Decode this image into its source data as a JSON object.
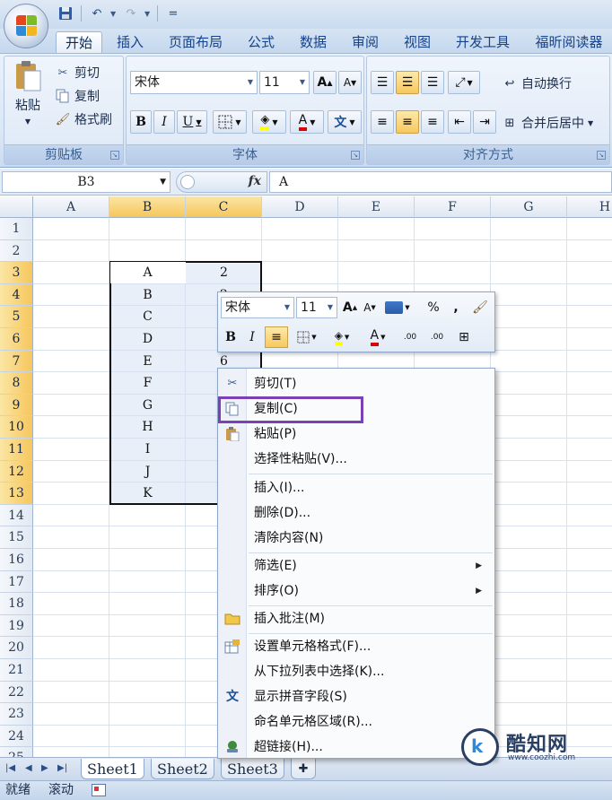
{
  "quick_access": {
    "save_icon": "save-icon",
    "undo_icon": "undo-icon",
    "redo_icon": "redo-icon",
    "customize": "="
  },
  "tabs": [
    "开始",
    "插入",
    "页面布局",
    "公式",
    "数据",
    "审阅",
    "视图",
    "开发工具",
    "福昕阅读器"
  ],
  "ribbon": {
    "clipboard": {
      "paste": "粘贴",
      "cut": "剪切",
      "copy": "复制",
      "format_painter": "格式刷",
      "label": "剪贴板"
    },
    "font": {
      "name": "宋体",
      "size": "11",
      "bold": "B",
      "italic": "I",
      "underline": "U",
      "label": "字体",
      "grow": "A",
      "shrink": "A",
      "font_color": "A",
      "phonetic": "文"
    },
    "alignment": {
      "wrap": "自动换行",
      "merge": "合并后居中",
      "label": "对齐方式"
    }
  },
  "formula_bar": {
    "name_box": "B3",
    "fx": "fx",
    "value": "A"
  },
  "columns": [
    "A",
    "B",
    "C",
    "D",
    "E",
    "F",
    "G",
    "H"
  ],
  "rows": [
    "1",
    "2",
    "3",
    "4",
    "5",
    "6",
    "7",
    "8",
    "9",
    "10",
    "11",
    "12",
    "13",
    "14",
    "15",
    "16",
    "17",
    "18",
    "19",
    "20",
    "21",
    "22",
    "23",
    "24",
    "25"
  ],
  "cells": {
    "B": [
      "A",
      "B",
      "C",
      "D",
      "E",
      "F",
      "G",
      "H",
      "I",
      "J",
      "K"
    ],
    "C": [
      "2",
      "2",
      "",
      "",
      "6"
    ]
  },
  "mini_toolbar": {
    "font": "宋体",
    "size": "11",
    "grow": "A",
    "shrink": "A",
    "percent": "%",
    "comma": ",",
    "bold": "B",
    "italic": "I",
    "font_color": "A",
    "inc_decimal": ".00",
    "dec_decimal": ".00"
  },
  "context_menu": {
    "items": [
      {
        "label": "剪切(T)",
        "icon": "scissors-icon"
      },
      {
        "label": "复制(C)",
        "icon": "copy-icon"
      },
      {
        "label": "粘贴(P)",
        "icon": "paste-icon"
      },
      {
        "label": "选择性粘贴(V)..."
      },
      {
        "label": "插入(I)..."
      },
      {
        "label": "删除(D)..."
      },
      {
        "label": "清除内容(N)"
      },
      {
        "label": "筛选(E)",
        "submenu": true
      },
      {
        "label": "排序(O)",
        "submenu": true
      },
      {
        "label": "插入批注(M)",
        "icon": "comment-icon"
      },
      {
        "label": "设置单元格格式(F)...",
        "icon": "format-cells-icon"
      },
      {
        "label": "从下拉列表中选择(K)..."
      },
      {
        "label": "显示拼音字段(S)",
        "icon": "phonetic-icon"
      },
      {
        "label": "命名单元格区域(R)..."
      },
      {
        "label": "超链接(H)...",
        "icon": "hyperlink-icon"
      }
    ]
  },
  "sheets": [
    "Sheet1",
    "Sheet2",
    "Sheet3"
  ],
  "status": {
    "ready": "就绪",
    "scroll": "滚动"
  },
  "watermark": {
    "logo": "k",
    "name": "酷知网",
    "url": "www.coozhi.com"
  },
  "colors": {
    "accent": "#15428b",
    "highlight_box": "#7b3fb6",
    "selection": "#f6c65c"
  }
}
